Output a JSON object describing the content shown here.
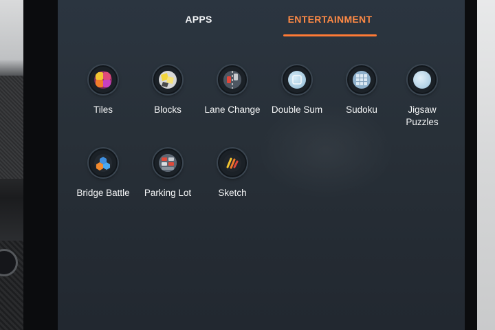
{
  "tabs": [
    {
      "label": "APPS",
      "active": false
    },
    {
      "label": "ENTERTAINMENT",
      "active": true
    }
  ],
  "colors": {
    "accent": "#ff7a35",
    "screen_background": "#283038",
    "label_text": "#f4f5f6"
  },
  "apps": [
    {
      "label": "Tiles",
      "icon": "tiles-icon"
    },
    {
      "label": "Blocks",
      "icon": "blocks-icon"
    },
    {
      "label": "Lane Change",
      "icon": "lane-change-icon"
    },
    {
      "label": "Double Sum",
      "icon": "double-sum-icon"
    },
    {
      "label": "Sudoku",
      "icon": "sudoku-icon"
    },
    {
      "label": "Jigsaw\nPuzzles",
      "icon": "jigsaw-puzzles-icon"
    },
    {
      "label": "Bridge Battle",
      "icon": "bridge-battle-icon"
    },
    {
      "label": "Parking Lot",
      "icon": "parking-lot-icon"
    },
    {
      "label": "Sketch",
      "icon": "sketch-icon"
    }
  ]
}
